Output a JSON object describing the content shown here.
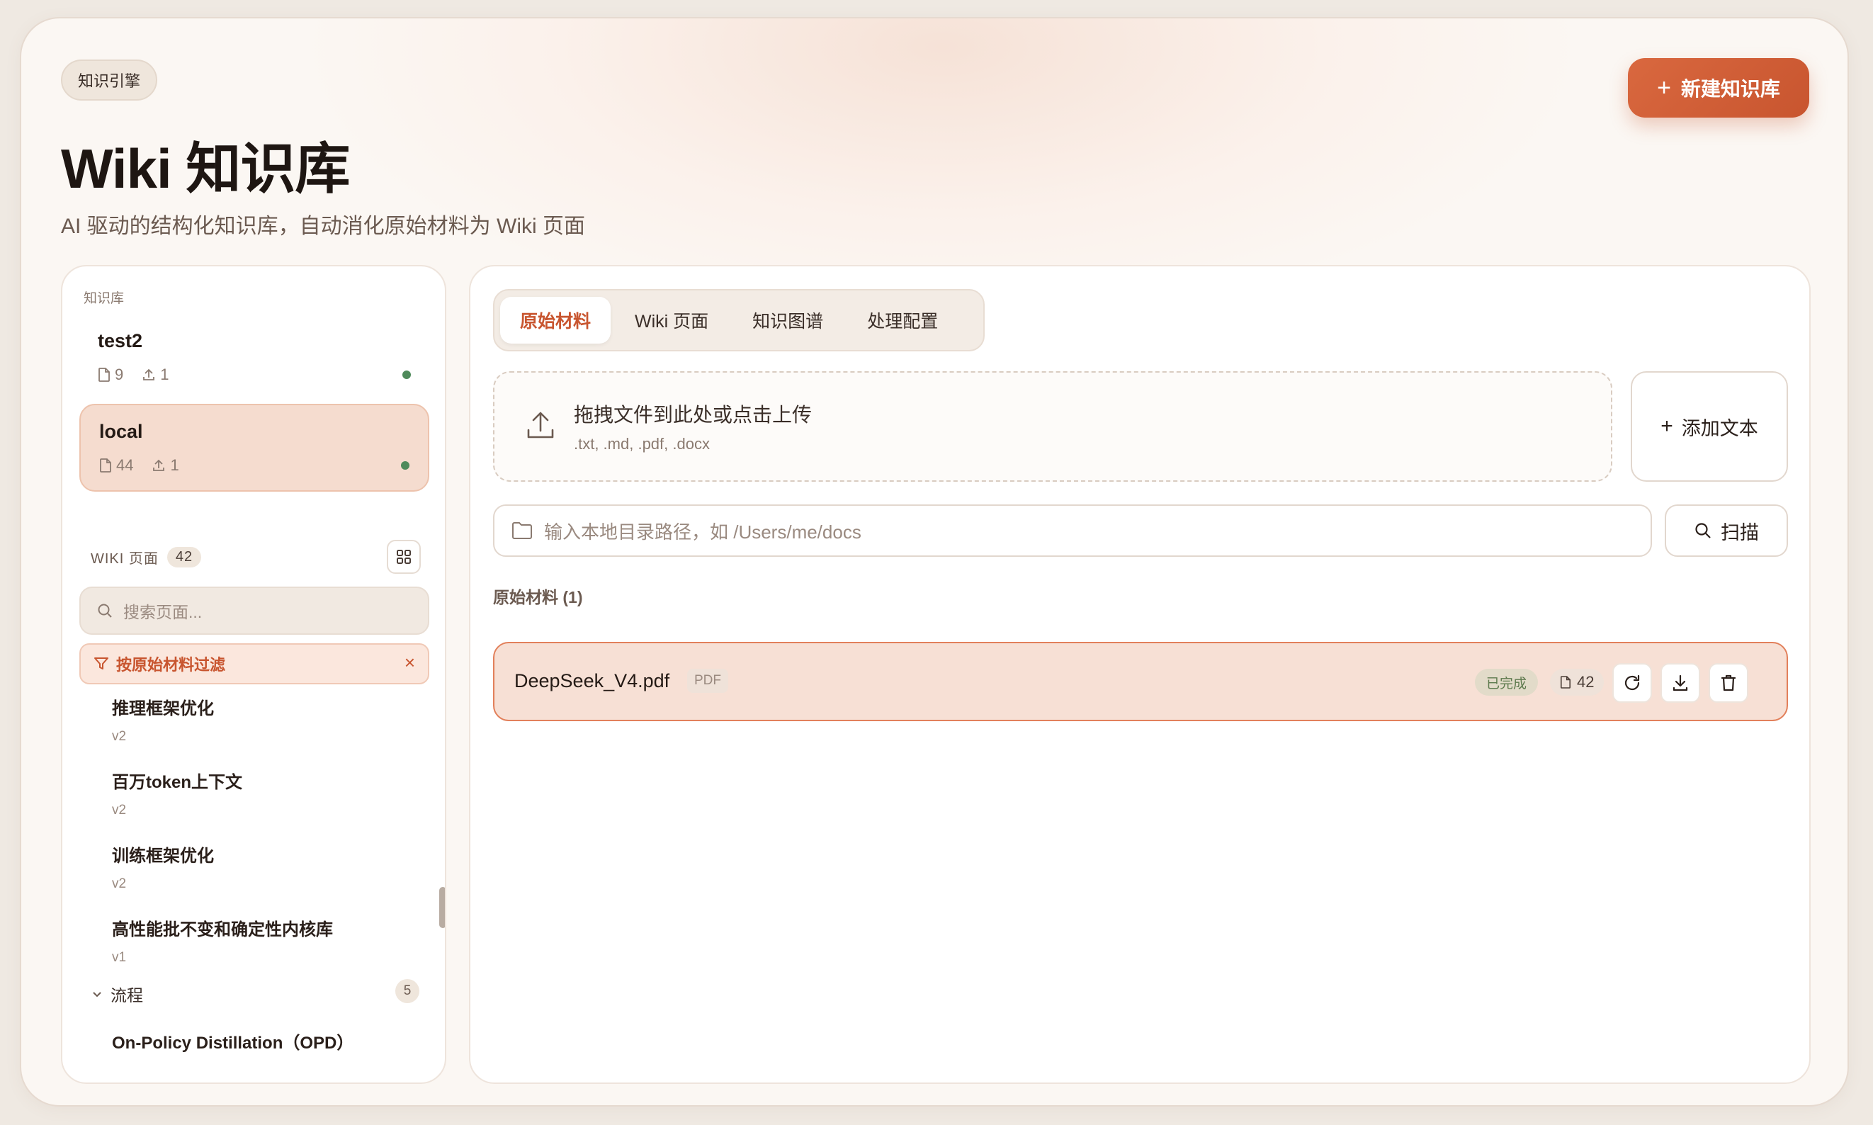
{
  "header": {
    "chip": "知识引擎",
    "title": "Wiki 知识库",
    "subtitle": "AI 驱动的结构化知识库，自动消化原始材料为 Wiki 页面",
    "new_button": "新建知识库"
  },
  "sidebar": {
    "section_label": "知识库",
    "knowledge_bases": [
      {
        "name": "test2",
        "docs": "9",
        "uploads": "1",
        "active": false
      },
      {
        "name": "local",
        "docs": "44",
        "uploads": "1",
        "active": true
      }
    ],
    "wiki_label": "WIKI 页面",
    "wiki_count": "42",
    "search_placeholder": "搜索页面...",
    "filter_label": "按原始材料过滤",
    "pages": [
      {
        "title": "推理框架优化",
        "version": "v2"
      },
      {
        "title": "百万token上下文",
        "version": "v2"
      },
      {
        "title": "训练框架优化",
        "version": "v2"
      },
      {
        "title": "高性能批不变和确定性内核库",
        "version": "v1"
      }
    ],
    "group": {
      "name": "流程",
      "count": "5"
    },
    "group_first_item": "On-Policy Distillation（OPD）"
  },
  "main": {
    "tabs": [
      "原始材料",
      "Wiki 页面",
      "知识图谱",
      "处理配置"
    ],
    "active_tab": 0,
    "dropzone": {
      "title": "拖拽文件到此处或点击上传",
      "formats": ".txt, .md, .pdf, .docx"
    },
    "add_text_button": "添加文本",
    "path_placeholder": "输入本地目录路径，如 /Users/me/docs",
    "scan_button": "扫描",
    "section_label": "原始材料 (1)",
    "files": [
      {
        "name": "DeepSeek_V4.pdf",
        "type": "PDF",
        "status": "已完成",
        "pages": "42"
      }
    ]
  },
  "colors": {
    "accent": "#c8552f",
    "active_bg": "#f5dccf",
    "status_green": "#4f8a5b"
  }
}
